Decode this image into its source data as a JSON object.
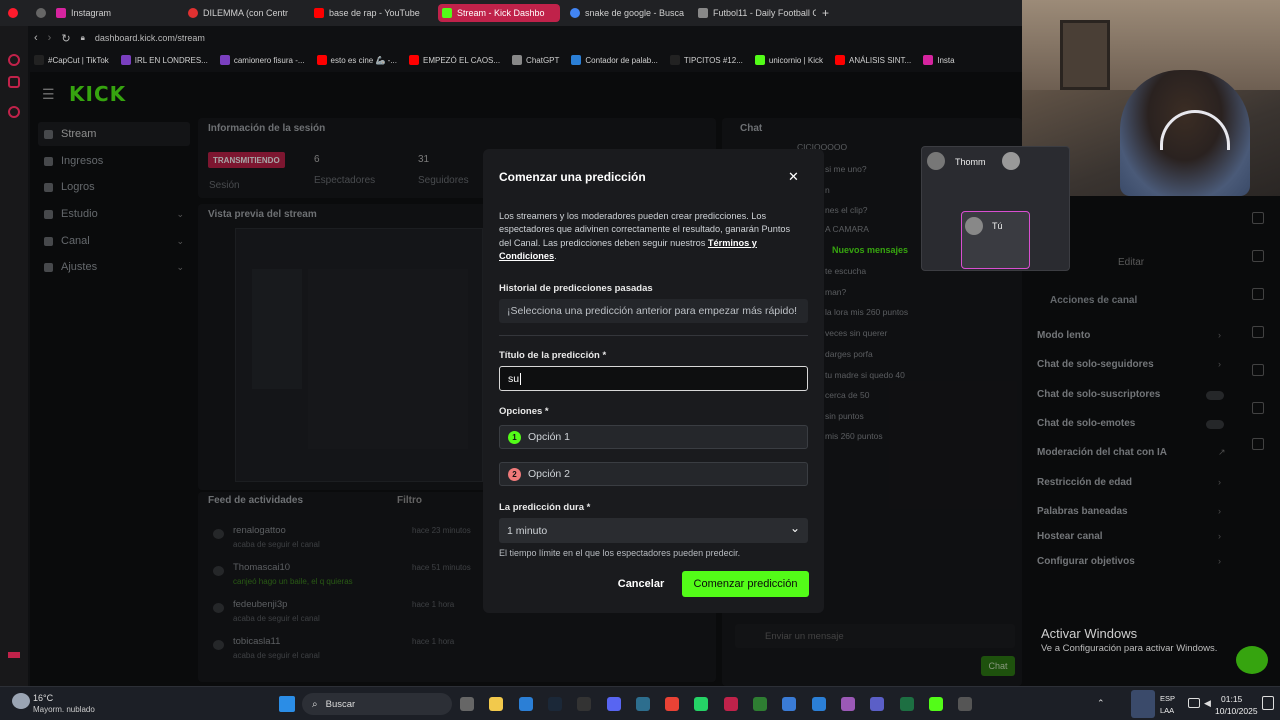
{
  "browser": {
    "tabs": [
      {
        "label": "Instagram",
        "color": "#d6249f"
      },
      {
        "label": "DILEMMA (con Centr",
        "color": "#e03131"
      },
      {
        "label": "base de rap - YouTube",
        "color": "#ff0000"
      },
      {
        "label": "Stream - Kick Dashbo",
        "color": "#53fc18"
      },
      {
        "label": "snake de google - Busca",
        "color": "#4285f4"
      },
      {
        "label": "Futbol11 - Daily Football G",
        "color": "#888888"
      }
    ],
    "new_tab": "+",
    "url": "dashboard.kick.com/stream",
    "bookmarks": [
      "#CapCut | TikTok",
      "IRL EN LONDRES...",
      "camionero fisura -...",
      "esto es cine 🦾 -...",
      "EMPEZÓ EL CAOS...",
      "ChatGPT",
      "Contador de palab...",
      "TIPCITOS #12...",
      "unicornio | Kick",
      "ANÁLISIS SINT...",
      "Insta"
    ]
  },
  "kick": {
    "logo": "KICK",
    "nav": [
      {
        "label": "Stream",
        "active": true
      },
      {
        "label": "Ingresos"
      },
      {
        "label": "Logros"
      },
      {
        "label": "Estudio",
        "expand": true
      },
      {
        "label": "Canal",
        "expand": true
      },
      {
        "label": "Ajustes",
        "expand": true
      }
    ],
    "session": {
      "title": "Información de la sesión",
      "badge": "TRANSMITIENDO",
      "badge_sub": "Sesión",
      "viewers": "6",
      "viewers_label": "Espectadores",
      "followers": "31",
      "followers_label": "Seguidores"
    },
    "preview_title": "Vista previa del stream",
    "feed": {
      "title": "Feed de actividades",
      "filter": "Filtro",
      "items": [
        {
          "user": "renalogattoo",
          "time": "hace 23 minutos",
          "desc": "acaba de seguir el canal"
        },
        {
          "user": "Thomascai10",
          "time": "hace 51 minutos",
          "desc": "canjeó hago un baile, el q quieras"
        },
        {
          "user": "fedeubenji3p",
          "time": "hace 1 hora",
          "desc": "acaba de seguir el canal"
        },
        {
          "user": "tobicasla11",
          "time": "hace 1 hora",
          "desc": "acaba de seguir el canal"
        }
      ]
    },
    "chat": {
      "title": "Chat",
      "lines": [
        "CICIOOOOO",
        "si me uno?",
        "n",
        "nes el clip?",
        "A CAMARA",
        "te escucha",
        "man?",
        "la lora mis 260 puntos",
        "veces sin querer",
        "darges porfa",
        "tu madre si quedo 40",
        "cerca de 50",
        "sin puntos",
        "mis 260 puntos"
      ],
      "new_messages": "Nuevos mensajes",
      "input_placeholder": "Enviar un mensaje",
      "send": "Chat"
    },
    "right_panel": {
      "edit": "Editar",
      "title": "Acciones de canal",
      "items": [
        "Modo lento",
        "Chat de solo-seguidores",
        "Chat de solo-suscriptores",
        "Chat de solo-emotes",
        "Moderación del chat con IA",
        "Restricción de edad",
        "Palabras baneadas",
        "Hostear canal",
        "Configurar objetivos"
      ]
    }
  },
  "modal": {
    "title": "Comenzar una predicción",
    "close": "✕",
    "description": "Los streamers y los moderadores pueden crear predicciones. Los espectadores que adivinen correctamente el resultado, ganarán Puntos del Canal. Las predicciones deben seguir nuestros",
    "terms": "Términos y Condiciones",
    "terms_suffix": ".",
    "history_label": "Historial de predicciones pasadas",
    "history_placeholder": "¡Selecciona una predicción anterior para empezar más rápido!",
    "title_label": "Título de la predicción *",
    "title_value": "su",
    "options_label": "Opciones *",
    "options": [
      {
        "num": "1",
        "placeholder": "Opción 1",
        "color": "#53fc18"
      },
      {
        "num": "2",
        "placeholder": "Opción 2",
        "color": "#f07a7a"
      }
    ],
    "duration_label": "La predicción dura *",
    "duration_value": "1 minuto",
    "duration_help": "El tiempo límite en el que los espectadores pueden predecir.",
    "cancel": "Cancelar",
    "start": "Comenzar predicción"
  },
  "call_widget": {
    "user1": "Thomm",
    "user2": "Tú"
  },
  "windows": {
    "activate_title": "Activar Windows",
    "activate_sub": "Ve a Configuración para activar Windows.",
    "weather_temp": "16°C",
    "weather_desc": "Mayorm. nublado",
    "search": "Buscar",
    "lang1": "ESP",
    "lang2": "LAA",
    "time": "01:15",
    "date": "10/10/2025"
  },
  "colors": {
    "accent": "#53fc18",
    "live_badge": "#c0224a"
  }
}
